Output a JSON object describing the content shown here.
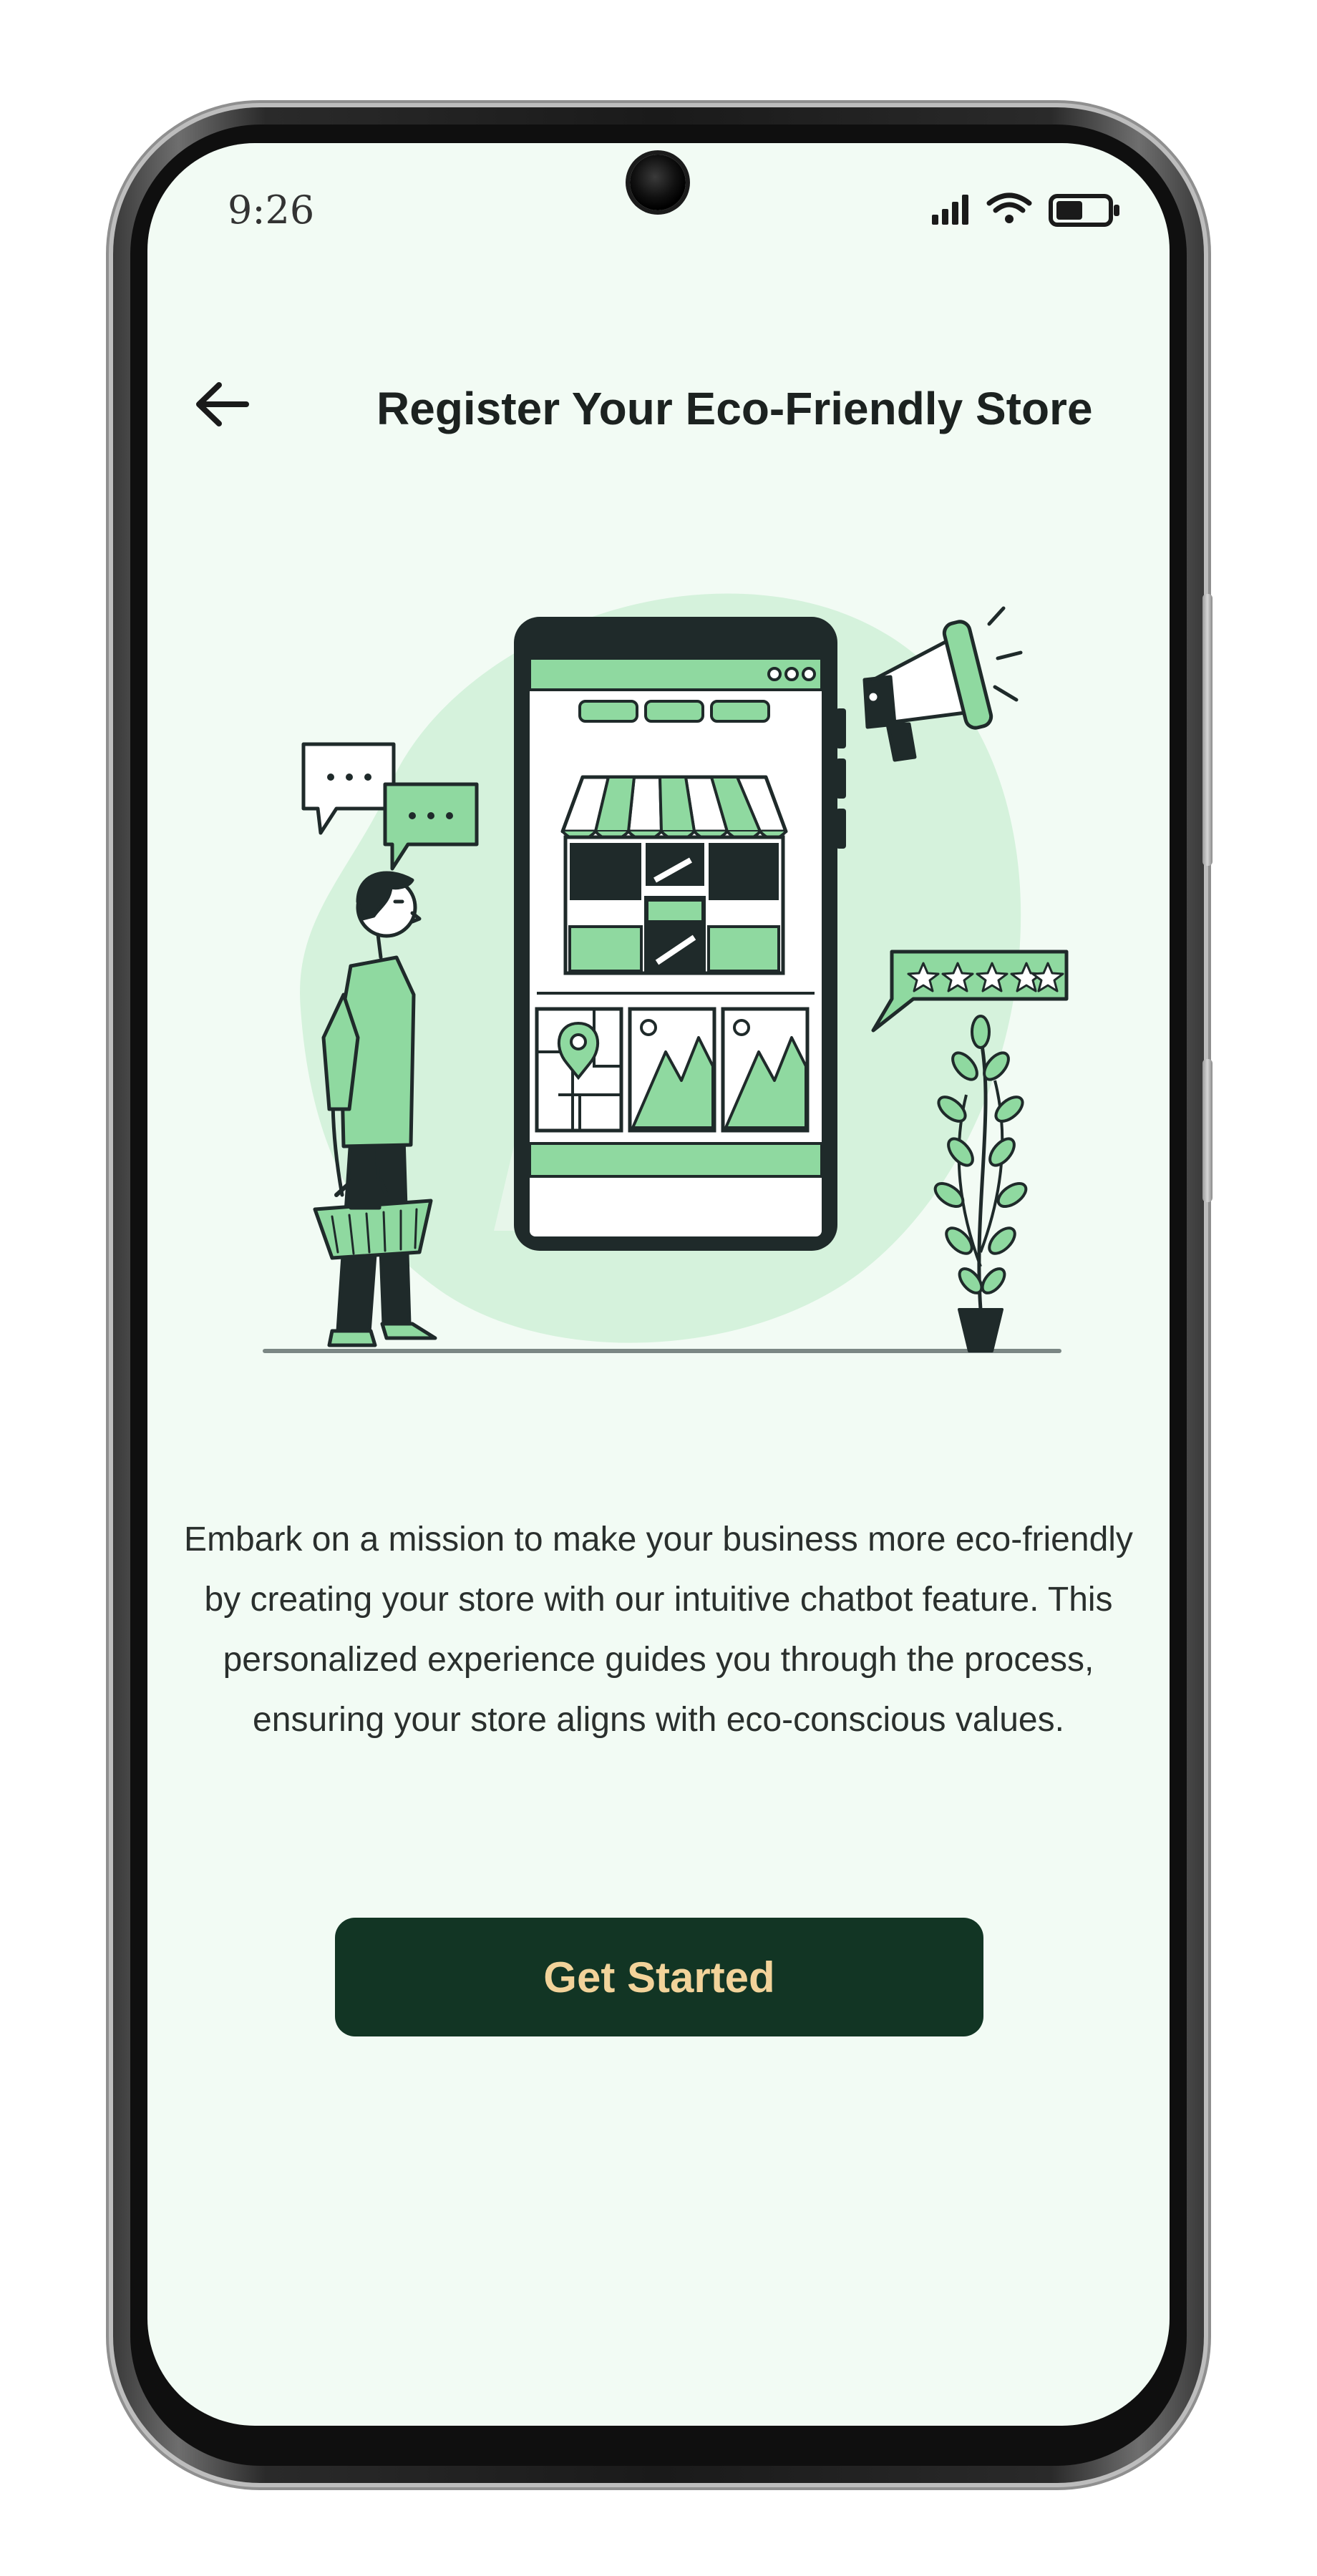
{
  "status_bar": {
    "time": "9:26",
    "icons": [
      "signal-icon",
      "wifi-icon",
      "battery-icon"
    ]
  },
  "header": {
    "back_icon": "arrow-left-icon",
    "title": "Register Your Eco-Friendly Store"
  },
  "illustration": {
    "icon": "store-registration-illustration"
  },
  "main": {
    "description": "Embark on a mission to make your business more eco-friendly by creating your store with our intuitive chatbot feature. This personalized experience guides you through the process, ensuring your store aligns with eco-conscious values."
  },
  "cta": {
    "label": "Get Started"
  },
  "colors": {
    "background": "#f2fbf4",
    "accent_green": "#8fd9a0",
    "dark_green": "#123524",
    "button_text": "#f2d39a",
    "ink": "#1f2a2a"
  }
}
